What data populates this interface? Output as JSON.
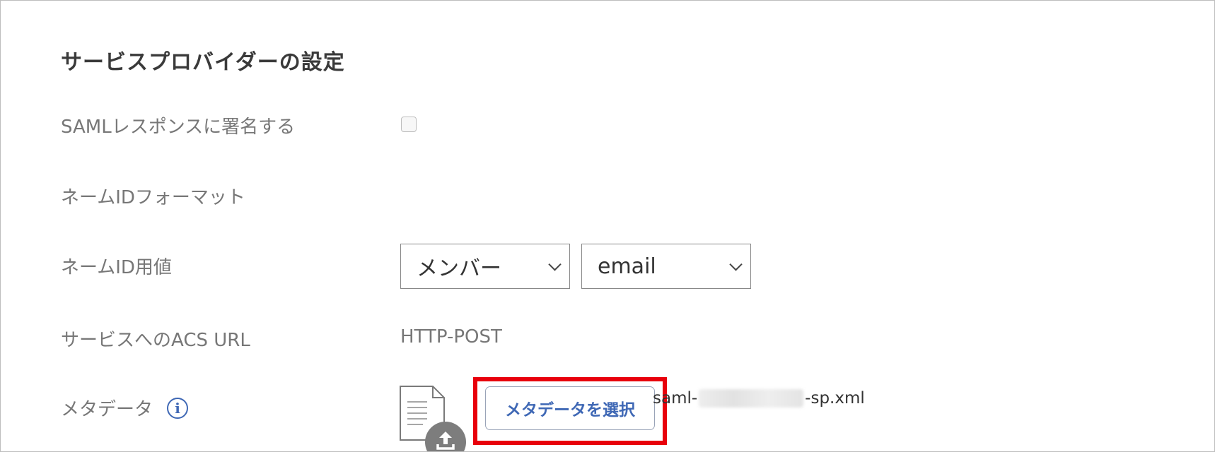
{
  "section": {
    "title": "サービスプロバイダーの設定"
  },
  "rows": {
    "saml_sign": {
      "label": "SAMLレスポンスに署名する",
      "checked": false
    },
    "nameid_format": {
      "label": "ネームIDフォーマット"
    },
    "nameid_value": {
      "label": "ネームID用値",
      "select_member": "メンバー",
      "select_field": "email"
    },
    "acs_url": {
      "label": "サービスへのACS URL",
      "value": "HTTP-POST"
    },
    "metadata": {
      "label": "メタデータ",
      "info_icon": "info-icon",
      "file_icon": "document-icon",
      "upload_icon": "upload-icon",
      "button_label": "メタデータを選択",
      "filename_prefix": "saml-",
      "filename_suffix": "-sp.xml"
    }
  },
  "colors": {
    "accent": "#3f68b5",
    "highlight": "#e8000b",
    "label": "#777777"
  }
}
